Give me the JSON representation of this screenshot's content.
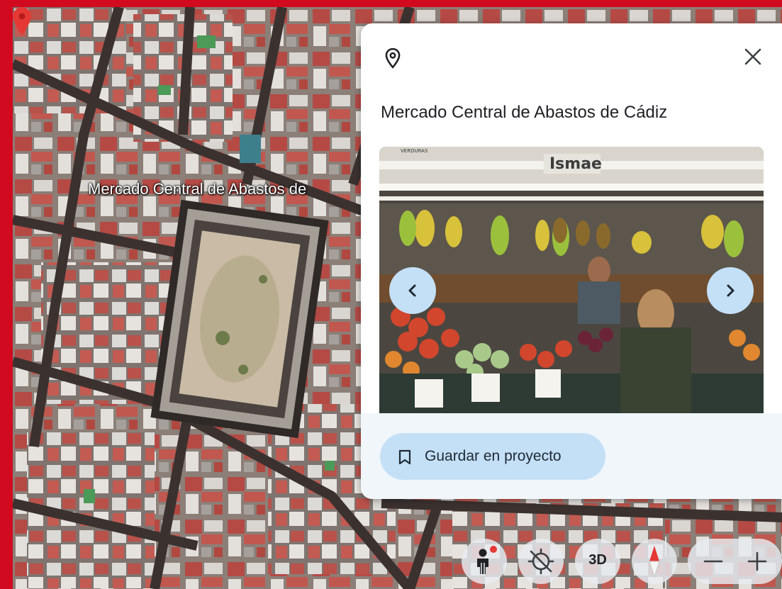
{
  "map": {
    "place_label": "Mercado Central de Abastos de"
  },
  "panel": {
    "title": "Mercado Central de Abastos de Cádiz",
    "save_label": "Guardar en proyecto",
    "photo_signs": [
      "VERDURAS",
      "Ismae"
    ]
  },
  "controls": {
    "three_d_label": "3D"
  },
  "colors": {
    "frame": "#d20a1f",
    "button_fill": "#c4e0f7",
    "pin": "#e53935"
  },
  "icons": [
    "location-pin-icon",
    "close-icon",
    "chevron-left-icon",
    "chevron-right-icon",
    "bookmark-icon",
    "pegman-icon",
    "rotate-icon",
    "compass-icon",
    "zoom-out-icon",
    "zoom-in-icon"
  ]
}
